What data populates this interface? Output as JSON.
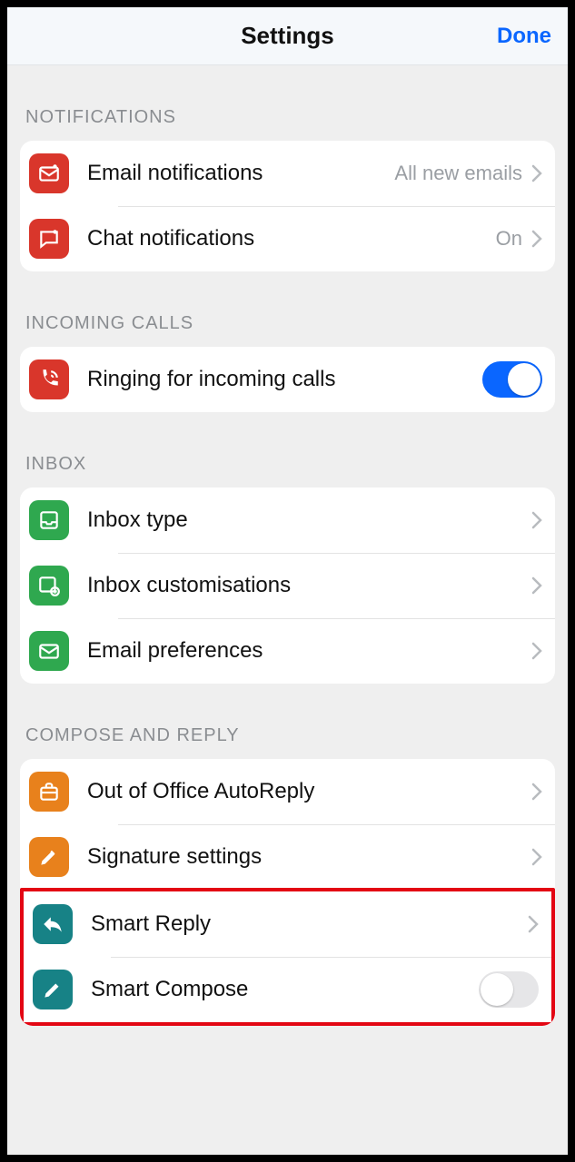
{
  "header": {
    "title": "Settings",
    "done": "Done"
  },
  "sections": {
    "notifications": {
      "header": "NOTIFICATIONS",
      "email_label": "Email notifications",
      "email_value": "All new emails",
      "chat_label": "Chat notifications",
      "chat_value": "On"
    },
    "calls": {
      "header": "INCOMING CALLS",
      "ringing_label": "Ringing for incoming calls",
      "ringing_on": true
    },
    "inbox": {
      "header": "INBOX",
      "type_label": "Inbox type",
      "custom_label": "Inbox customisations",
      "pref_label": "Email preferences"
    },
    "compose": {
      "header": "COMPOSE AND REPLY",
      "ooo_label": "Out of Office AutoReply",
      "sig_label": "Signature settings",
      "smartreply_label": "Smart Reply",
      "smartcompose_label": "Smart Compose",
      "smartcompose_on": false
    }
  }
}
